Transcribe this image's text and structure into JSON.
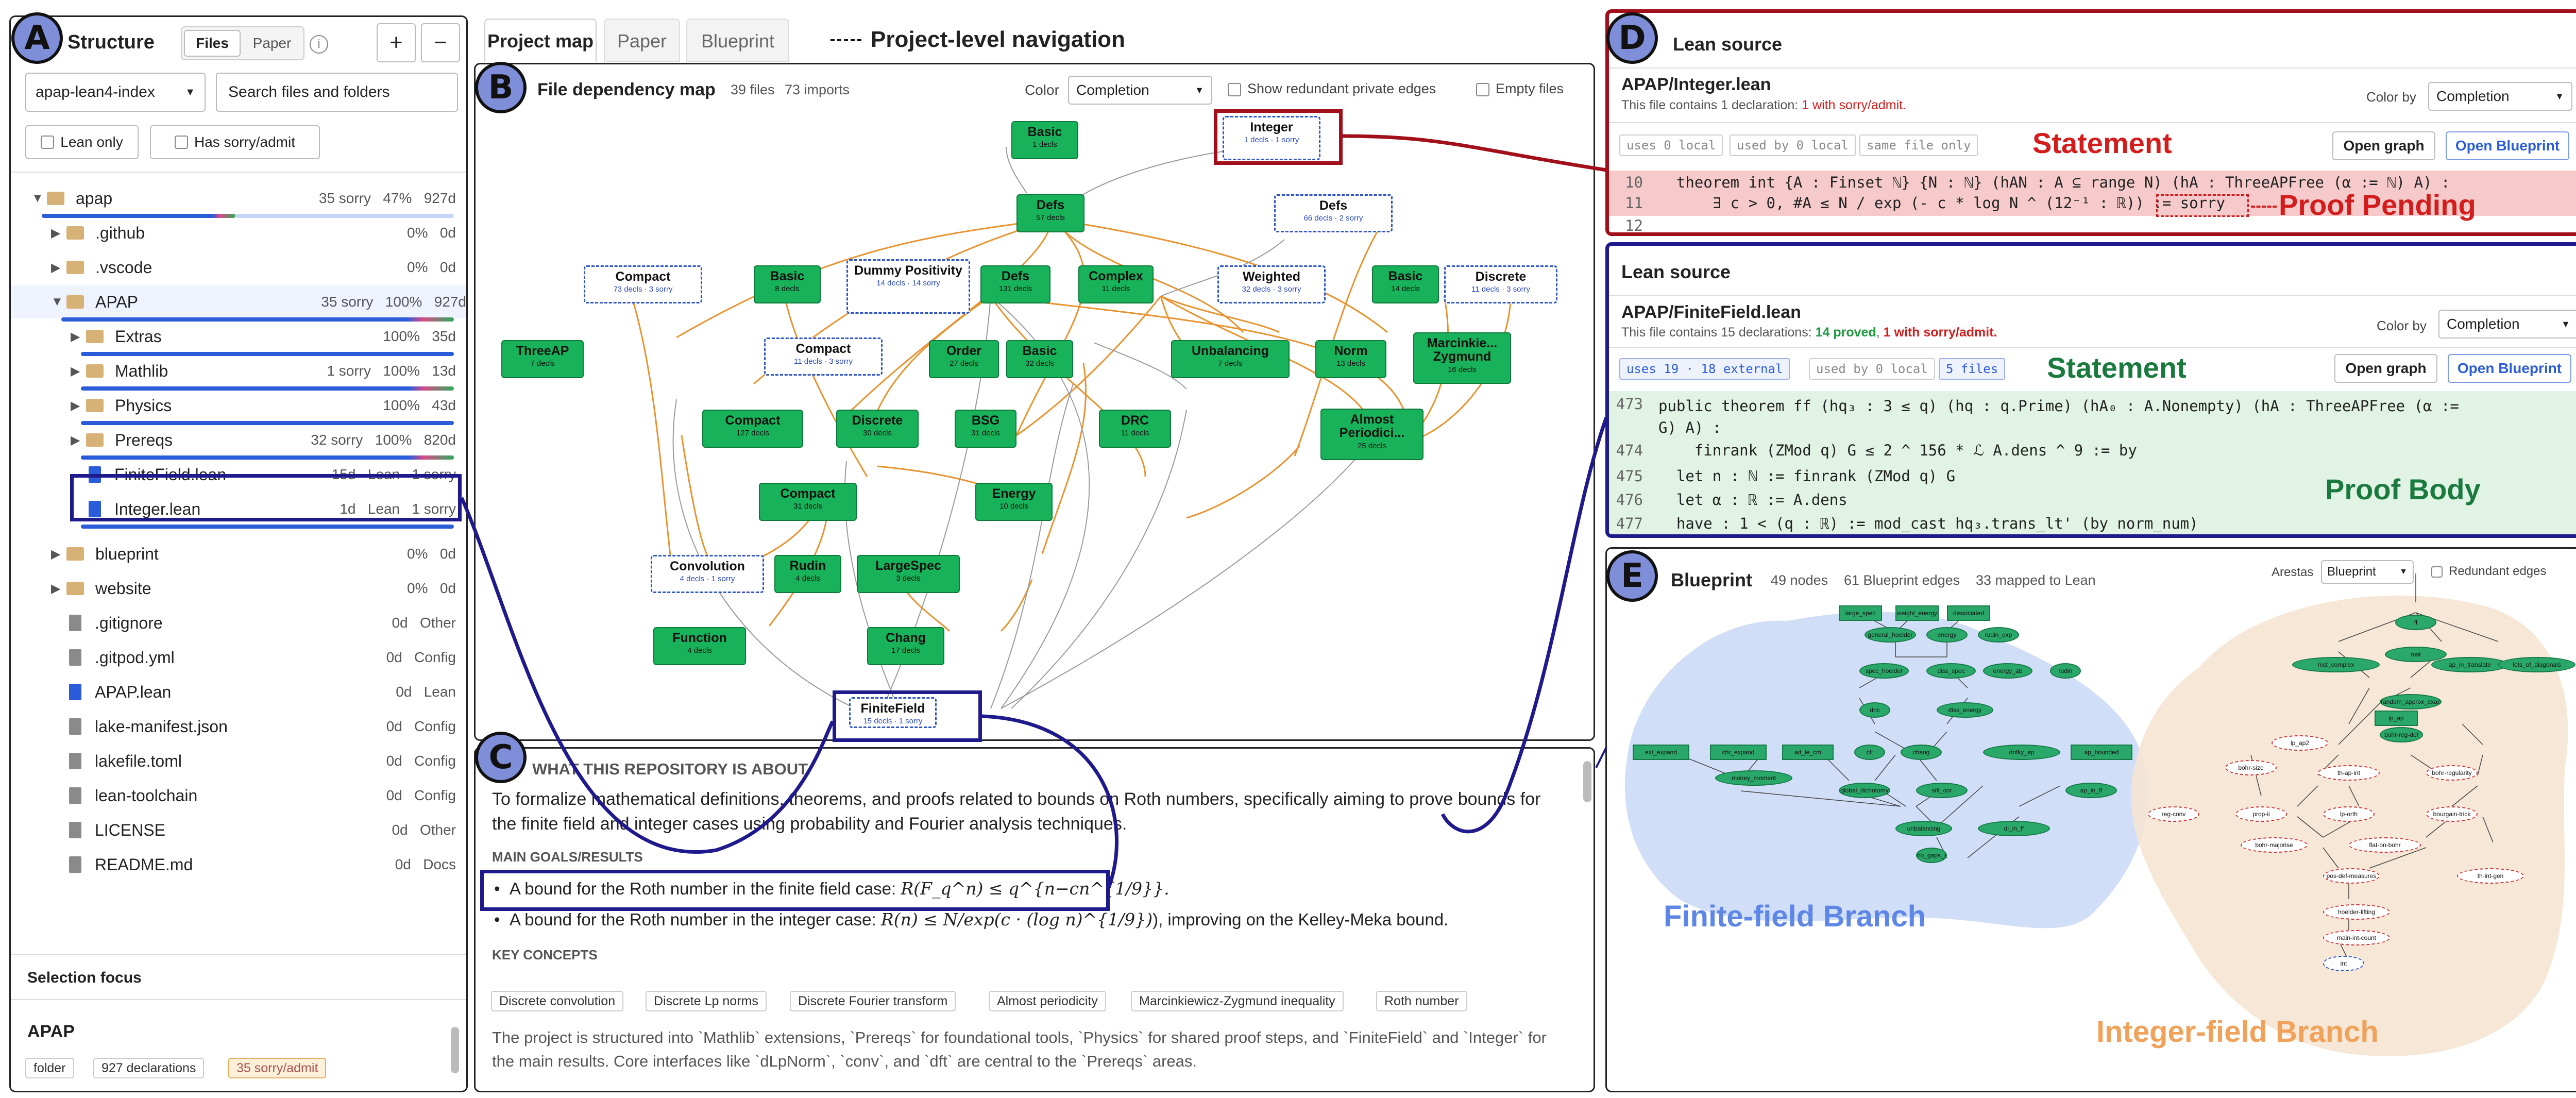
{
  "sidebar": {
    "title": "Structure",
    "tabs": [
      "Files",
      "Paper"
    ],
    "info_icon": "info-icon",
    "expand_label": "+",
    "collapse_label": "−",
    "repo_select": "apap-lean4-index",
    "search_placeholder": "Search files and folders",
    "filters": [
      "Lean only",
      "Has sorry/admit"
    ],
    "tree": [
      {
        "name": "apap",
        "meta": "35 sorry   47%   927d",
        "type": "folder",
        "expanded": true
      },
      {
        "name": ".github",
        "meta": "0%   0d",
        "type": "folder"
      },
      {
        "name": ".vscode",
        "meta": "0%   0d",
        "type": "folder"
      },
      {
        "name": "APAP",
        "meta": "35 sorry   100%   927d",
        "type": "folder",
        "expanded": true
      },
      {
        "name": "Extras",
        "meta": "100%   35d",
        "type": "folder"
      },
      {
        "name": "Mathlib",
        "meta": "1 sorry   100%   13d",
        "type": "folder"
      },
      {
        "name": "Physics",
        "meta": "100%   43d",
        "type": "folder"
      },
      {
        "name": "Prereqs",
        "meta": "32 sorry   100%   820d",
        "type": "folder"
      },
      {
        "name": "FiniteField.lean",
        "meta": "15d   Lean   1 sorry",
        "type": "lean"
      },
      {
        "name": "Integer.lean",
        "meta": "1d   Lean   1 sorry",
        "type": "lean"
      },
      {
        "name": "blueprint",
        "meta": "0%   0d",
        "type": "folder"
      },
      {
        "name": "website",
        "meta": "0%   0d",
        "type": "folder"
      },
      {
        "name": ".gitignore",
        "meta": "0d   Other",
        "type": "file"
      },
      {
        "name": ".gitpod.yml",
        "meta": "0d   Config",
        "type": "file"
      },
      {
        "name": "APAP.lean",
        "meta": "0d   Lean",
        "type": "lean"
      },
      {
        "name": "lake-manifest.json",
        "meta": "0d   Config",
        "type": "file"
      },
      {
        "name": "lakefile.toml",
        "meta": "0d   Config",
        "type": "file"
      },
      {
        "name": "lean-toolchain",
        "meta": "0d   Config",
        "type": "file"
      },
      {
        "name": "LICENSE",
        "meta": "0d   Other",
        "type": "file"
      },
      {
        "name": "README.md",
        "meta": "0d   Docs",
        "type": "file"
      }
    ],
    "selection": {
      "heading": "Selection focus",
      "name": "APAP",
      "chips": [
        "folder",
        "927 declarations",
        "35 sorry/admit"
      ]
    }
  },
  "nav": {
    "tabs": [
      "Project map",
      "Paper",
      "Blueprint"
    ],
    "annotation": "Project-level navigation"
  },
  "depmap": {
    "title": "File dependency map",
    "files": "39 files",
    "imports": "73 imports",
    "color_label": "Color",
    "color_value": "Completion",
    "opt_redundant": "Show redundant private edges",
    "opt_empty": "Empty files",
    "nodes": [
      {
        "name": "Basic",
        "sub": "1 decls"
      },
      {
        "name": "Integer",
        "sub": "1 decls · 1 sorry"
      },
      {
        "name": "Defs",
        "sub": "57 decls"
      },
      {
        "name": "Defs",
        "sub": "66 decls · 2 sorry"
      },
      {
        "name": "Compact",
        "sub": "73 decls · 3 sorry"
      },
      {
        "name": "Basic",
        "sub": "8 decls"
      },
      {
        "name": "Dummy Positivity",
        "sub": "14 decls · 14 sorry"
      },
      {
        "name": "Defs",
        "sub": "131 decls"
      },
      {
        "name": "Complex",
        "sub": "11 decls"
      },
      {
        "name": "Weighted",
        "sub": "32 decls · 3 sorry"
      },
      {
        "name": "Basic",
        "sub": "14 decls"
      },
      {
        "name": "Discrete",
        "sub": "11 decls · 3 sorry"
      },
      {
        "name": "ThreeAP",
        "sub": "7 decls"
      },
      {
        "name": "Compact",
        "sub": "11 decls · 3 sorry"
      },
      {
        "name": "Order",
        "sub": "27 decls"
      },
      {
        "name": "Basic",
        "sub": "32 decls"
      },
      {
        "name": "Unbalancing",
        "sub": "7 decls"
      },
      {
        "name": "Norm",
        "sub": "13 decls"
      },
      {
        "name": "Marcinkie... Zygmund",
        "sub": "16 decls"
      },
      {
        "name": "Compact",
        "sub": "127 decls"
      },
      {
        "name": "Discrete",
        "sub": "30 decls"
      },
      {
        "name": "BSG",
        "sub": "31 decls"
      },
      {
        "name": "DRC",
        "sub": "11 decls"
      },
      {
        "name": "Almost Periodici...",
        "sub": "25 decls"
      },
      {
        "name": "Compact",
        "sub": "31 decls"
      },
      {
        "name": "Energy",
        "sub": "10 decls"
      },
      {
        "name": "Convolution",
        "sub": "4 decls · 1 sorry"
      },
      {
        "name": "Rudin",
        "sub": "4 decls"
      },
      {
        "name": "LargeSpec",
        "sub": "3 decls"
      },
      {
        "name": "Function",
        "sub": "4 decls"
      },
      {
        "name": "Chang",
        "sub": "17 decls"
      },
      {
        "name": "FiniteField",
        "sub": "15 decls · 1 sorry"
      }
    ]
  },
  "about": {
    "heading": "WHAT THIS REPOSITORY IS ABOUT",
    "summary": "To formalize mathematical definitions, theorems, and proofs related to bounds on Roth numbers, specifically aiming to prove bounds for the finite field and integer cases using probability and Fourier analysis techniques.",
    "goals_heading": "MAIN GOALS/RESULTS",
    "goal1_text": "A bound for the Roth number in the finite field case: ",
    "goal1_math": "R(F_q^n) ≤ q^{n−cn^{1/9}}.",
    "goal2_text": "A bound for the Roth number in the integer case: ",
    "goal2_math": "R(n) ≤ N/exp(c · (log n)^{1/9})",
    "goal2_tail": "), improving on the Kelley-Meka bound.",
    "concepts_heading": "KEY CONCEPTS",
    "concepts": [
      "Discrete convolution",
      "Discrete Lp norms",
      "Discrete Fourier transform",
      "Almost periodicity",
      "Marcinkiewicz-Zygmund inequality",
      "Roth number"
    ],
    "structure": "The project is structured into `Mathlib` extensions, `Prereqs` for foundational tools, `Physics` for shared proof steps, and `FiniteField` and `Integer` for the main results. Core interfaces like `dLpNorm`, `conv`, and `dft` are central to the `Prereqs` areas."
  },
  "lean1": {
    "title": "Lean source",
    "file": "APAP/Integer.lean",
    "info_prefix": "This file contains 1 declaration: ",
    "info_sorry": "1 with sorry/admit.",
    "color_by": "Color by",
    "color_value": "Completion",
    "chips": [
      "uses 0 local",
      "used by 0 local",
      "same file only"
    ],
    "open_graph": "Open graph",
    "open_blueprint": "Open Blueprint",
    "lines": [
      {
        "n": "10",
        "t": "  theorem int {A : Finset ℕ} {N : ℕ} (hAN : A ⊆ range N) (hA : ThreeAPFree (α := ℕ) A) :"
      },
      {
        "n": "11",
        "t": "      ∃ c > 0, #A ≤ N / exp (- c * log N ^ (12⁻¹ : ℝ)) := sorry"
      },
      {
        "n": "12",
        "t": ""
      }
    ],
    "ann_statement": "Statement",
    "ann_pending": "Proof Pending"
  },
  "lean2": {
    "title": "Lean source",
    "file": "APAP/FiniteField.lean",
    "info_prefix": "This file contains 15 declarations: ",
    "info_proved": "14 proved",
    "info_sep": ", ",
    "info_sorry": "1 with sorry/admit.",
    "color_by": "Color by",
    "color_value": "Completion",
    "chips": [
      "uses 19 · 18 external",
      "used by 0 local",
      "5 files"
    ],
    "open_graph": "Open graph",
    "open_blueprint": "Open Blueprint",
    "lines": [
      {
        "n": "473",
        "t": "public theorem ff (hq₃ : 3 ≤ q) (hq : q.Prime) (hA₀ : A.Nonempty) (hA : ThreeAPFree (α :=\nG) A) :"
      },
      {
        "n": "474",
        "t": "    finrank (ZMod q) G ≤ 2 ^ 156 * ℒ A.dens ^ 9 := by"
      },
      {
        "n": "475",
        "t": "  let n : ℕ := finrank (ZMod q) G"
      },
      {
        "n": "476",
        "t": "  let α : ℝ := A.dens"
      },
      {
        "n": "477",
        "t": "  have : 1 < (q : ℝ) := mod_cast hq₃.trans_lt' (by norm_num)"
      }
    ],
    "ann_statement": "Statement",
    "ann_body": "Proof Body"
  },
  "blueprint": {
    "title": "Blueprint",
    "nodes": "49 nodes",
    "edges": "61 Blueprint edges",
    "mapped": "33 mapped to Lean",
    "arestas_label": "Arestas",
    "arestas_value": "Blueprint",
    "redundant": "Redundant edges",
    "branch_ff": "Finite-field Branch",
    "branch_int": "Integer-field Branch",
    "bp_nodes": [
      "large_spec",
      "weight_energy",
      "dissociated",
      "general_hoelder",
      "energy",
      "rudin_exp",
      "spec_hoelder",
      "diss_spec",
      "energy_ab",
      "rudin",
      "dnc",
      "diss_energy",
      "ext_expand",
      "chr_expand",
      "ad_le_cm",
      "cft",
      "chang",
      "dnfky_ap",
      "ap_bounded",
      "money_moment",
      "global_dichotomy",
      "sift_cor",
      "ap_in_ff",
      "unbalancing",
      "di_in_ff",
      "no_gaps_sign_prop",
      "ff",
      "mst",
      "mst_complex",
      "ap_in_translate",
      "lots_of_diagonals",
      "random_approx_exact",
      "lp_ap",
      "bohr-reg-def",
      "lp_ap2",
      "bohr-size",
      "th-ap-int",
      "bohr-regularity",
      "reg-conv",
      "prop-ii",
      "lp-orth",
      "bourgain-trick",
      "bohr-majorise",
      "flat-on-bohr",
      "pos-def-measures",
      "th-int-gen",
      "hoelder-lifting",
      "main-int-count",
      "int"
    ]
  },
  "badges": [
    "A",
    "B",
    "C",
    "D",
    "E"
  ]
}
